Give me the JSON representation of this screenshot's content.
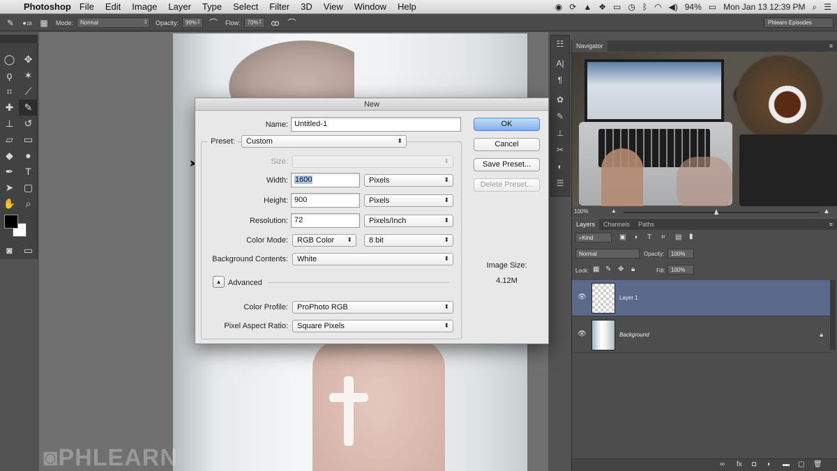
{
  "menubar": {
    "apple_icon": "apple-logo-icon",
    "app_name": "Photoshop",
    "items": [
      "File",
      "Edit",
      "Image",
      "Layer",
      "Type",
      "Select",
      "Filter",
      "3D",
      "View",
      "Window",
      "Help"
    ],
    "battery": "94%",
    "clock": "Mon Jan 13  12:39 PM"
  },
  "options_bar": {
    "brush_size": "18",
    "mode_label": "Mode:",
    "mode_value": "Normal",
    "opacity_label": "Opacity:",
    "opacity_value": "99%",
    "flow_label": "Flow:",
    "flow_value": "70%",
    "workspace": "Phlearn Episodes"
  },
  "dialog": {
    "title": "New",
    "name_label": "Name:",
    "name_value": "Untitled-1",
    "preset_label": "Preset:",
    "preset_value": "Custom",
    "size_label": "Size:",
    "width_label": "Width:",
    "width_value": "1600",
    "width_unit": "Pixels",
    "height_label": "Height:",
    "height_value": "900",
    "height_unit": "Pixels",
    "resolution_label": "Resolution:",
    "resolution_value": "72",
    "resolution_unit": "Pixels/Inch",
    "color_mode_label": "Color Mode:",
    "color_mode_value": "RGB Color",
    "bit_depth": "8 bit",
    "background_label": "Background Contents:",
    "background_value": "White",
    "advanced_label": "Advanced",
    "color_profile_label": "Color Profile:",
    "color_profile_value": "ProPhoto RGB",
    "pixel_aspect_label": "Pixel Aspect Ratio:",
    "pixel_aspect_value": "Square Pixels",
    "ok": "OK",
    "cancel": "Cancel",
    "save_preset": "Save Preset...",
    "delete_preset": "Delete Preset...",
    "image_size_label": "Image Size:",
    "image_size_value": "4.12M"
  },
  "navigator": {
    "tab": "Navigator",
    "zoom": "100%"
  },
  "layers": {
    "tabs": [
      "Layers",
      "Channels",
      "Paths"
    ],
    "kind_filter": "Kind",
    "blend_mode": "Normal",
    "opacity_label": "Opacity:",
    "opacity_value": "100%",
    "lock_label": "Lock:",
    "fill_label": "Fill:",
    "fill_value": "100%",
    "items": [
      {
        "name": "Layer 1"
      },
      {
        "name": "Background"
      }
    ]
  },
  "watermark": "PHLEARN"
}
